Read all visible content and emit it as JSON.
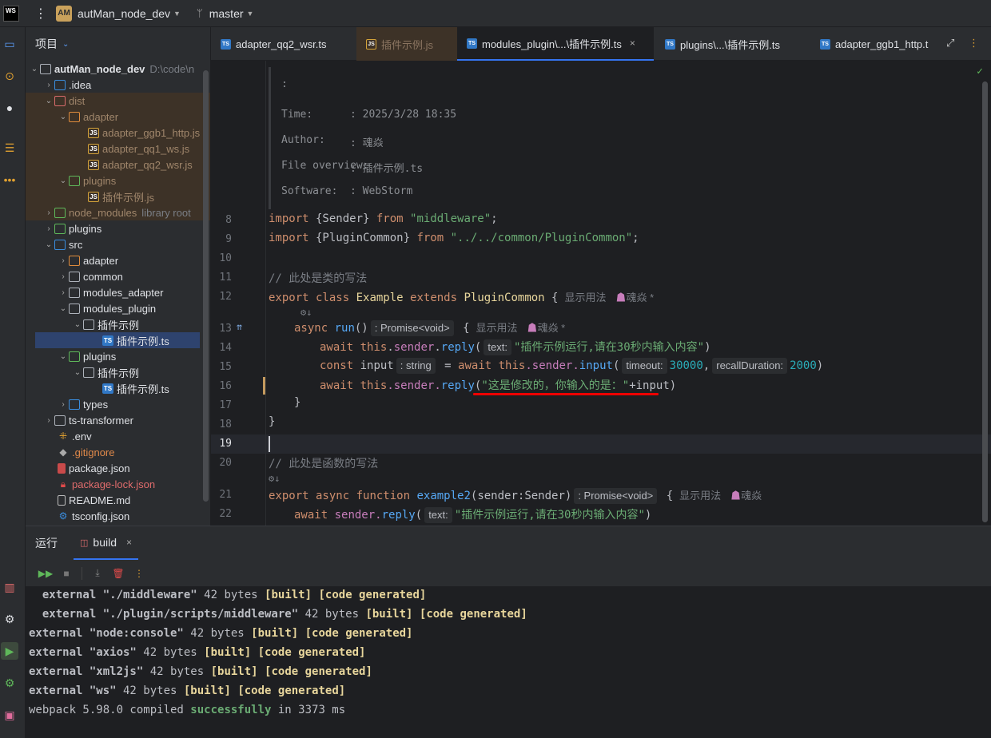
{
  "titlebar": {
    "logo_text": "WS",
    "menu_glyph": "⋮",
    "project_badge": "AM",
    "project_name": "autMan_node_dev",
    "branch": "master"
  },
  "project_panel": {
    "title": "项目",
    "tree": [
      {
        "label": "autMan_node_dev",
        "hint": "D:\\code\\n",
        "arrow": "⌄",
        "icon": "folder"
      },
      {
        "label": ".idea",
        "arrow": "›",
        "icon": "folder"
      },
      {
        "label": "dist",
        "arrow": "⌄",
        "icon": "folder"
      },
      {
        "label": "adapter",
        "arrow": "⌄",
        "icon": "folder"
      },
      {
        "label": "adapter_ggb1_http.js",
        "icon": "JS"
      },
      {
        "label": "adapter_qq1_ws.js",
        "icon": "JS"
      },
      {
        "label": "adapter_qq2_wsr.js",
        "icon": "JS"
      },
      {
        "label": "plugins",
        "arrow": "⌄",
        "icon": "folder"
      },
      {
        "label": "插件示例.js",
        "icon": "JS"
      },
      {
        "label": "node_modules",
        "hint": "library root",
        "arrow": "›",
        "icon": "folder"
      },
      {
        "label": "plugins",
        "arrow": "›",
        "icon": "folder"
      },
      {
        "label": "src",
        "arrow": "⌄",
        "icon": "folder"
      },
      {
        "label": "adapter",
        "arrow": "›",
        "icon": "folder"
      },
      {
        "label": "common",
        "arrow": "›",
        "icon": "folder"
      },
      {
        "label": "modules_adapter",
        "arrow": "›",
        "icon": "folder"
      },
      {
        "label": "modules_plugin",
        "arrow": "⌄",
        "icon": "folder"
      },
      {
        "label": "插件示例",
        "arrow": "⌄",
        "icon": "folder"
      },
      {
        "label": "插件示例.ts",
        "icon": "TS"
      },
      {
        "label": "plugins",
        "arrow": "⌄",
        "icon": "folder"
      },
      {
        "label": "插件示例",
        "arrow": "⌄",
        "icon": "folder"
      },
      {
        "label": "插件示例.ts",
        "icon": "TS"
      },
      {
        "label": "types",
        "arrow": "›",
        "icon": "folder"
      },
      {
        "label": "ts-transformer",
        "arrow": "›",
        "icon": "folder"
      },
      {
        "label": ".env",
        "icon": "env"
      },
      {
        "label": ".gitignore",
        "icon": "git"
      },
      {
        "label": "package.json",
        "icon": "json"
      },
      {
        "label": "package-lock.json",
        "icon": "lock"
      },
      {
        "label": "README.md",
        "icon": "md"
      },
      {
        "label": "tsconfig.json",
        "icon": "ts-config"
      }
    ]
  },
  "tabs": [
    {
      "label": "adapter_qq2_wsr.ts",
      "icon": "TS"
    },
    {
      "label": "插件示例.js",
      "icon": "JS"
    },
    {
      "label": "modules_plugin\\...\\插件示例.ts",
      "icon": "TS",
      "close": "×"
    },
    {
      "label": "plugins\\...\\插件示例.ts",
      "icon": "TS"
    },
    {
      "label": "adapter_ggb1_http.t",
      "icon": "TS"
    }
  ],
  "editor": {
    "doc": {
      "colon": ":",
      "time_label": "Time:",
      "time_value": ": 2025/3/28 18:35",
      "author_label": "Author:",
      "author_value": ": 魂焱",
      "overview_label": "File overview:",
      "overview_value": ": 插件示例.ts",
      "software_label": "Software:",
      "software_value": ": WebStorm"
    },
    "line_numbers": [
      "8",
      "9",
      "10",
      "11",
      "12",
      "13",
      "14",
      "15",
      "16",
      "17",
      "18",
      "19",
      "20",
      "21",
      "22"
    ],
    "code": {
      "l8_import": "import",
      "l8_sender": " {Sender} ",
      "l8_from": "from",
      "l8_mod": " \"middleware\"",
      "l8_semi": ";",
      "l9_import": "import",
      "l9_pc": " {PluginCommon} ",
      "l9_from": "from",
      "l9_mod": " \"../../common/PluginCommon\"",
      "l9_semi": ";",
      "l11_comment": "// 此处是类的写法",
      "l12_export": "export",
      "l12_class": " class ",
      "l12_name": "Example",
      "l12_extends": " extends ",
      "l12_parent": "PluginCommon",
      "l12_brace": " {",
      "lens_usages": "显示用法",
      "lens_author": "魂焱 *",
      "lens_author_plain": "魂焱",
      "l13_async": "async",
      "l13_run": " run",
      "l13_paren": "()",
      "l13_hint": ": Promise<void>",
      "l13_brace": " {",
      "l14_await": "await",
      "l14_this": " this",
      "l14_dot": ".",
      "l14_sender": "sender",
      "l14_dot2": ".",
      "l14_reply": "reply",
      "l14_paren": "(",
      "l14_hint": "text:",
      "l14_str": "\"插件示例运行,请在30秒内输入内容\"",
      "l14_close": ")",
      "l15_const": "const",
      "l15_input": " input",
      "l15_hint": ": string",
      "l15_eq": " = ",
      "l15_await": "await",
      "l15_this": " this",
      "l15_sender": ".sender.",
      "l15_input_fn": "input",
      "l15_paren": "(",
      "l15_hint2": "timeout:",
      "l15_num1": "30000",
      "l15_comma": ",",
      "l15_hint3": "recallDuration:",
      "l15_num2": "2000",
      "l15_close": ")",
      "l16_await": "await",
      "l16_this": " this",
      "l16_sender": ".sender.",
      "l16_reply": "reply",
      "l16_paren": "(",
      "l16_str": "\"这是修改的，你输入的是：\"",
      "l16_rest": "+input)",
      "l17_brace": "}",
      "l18_brace": "}",
      "l20_comment": "// 此处是函数的写法",
      "l21_export": "export",
      "l21_async": " async ",
      "l21_function": "function",
      "l21_name": " example2",
      "l21_params": "(sender:Sender)",
      "l21_hint": ": Promise<void>",
      "l21_brace": " {",
      "l22_await": "await",
      "l22_sender": " sender.",
      "l22_reply": "reply",
      "l22_paren": "(",
      "l22_hint": "text:",
      "l22_str": "\"插件示例运行,请在30秒内输入内容\"",
      "l22_close": ")",
      "sub_hint": "⚙↓"
    }
  },
  "bottom": {
    "run_label": "运行",
    "build_label": "build",
    "build_close": "×",
    "console": [
      {
        "a": "  external ",
        "b": "\"./middleware\"",
        "c": " 42 bytes ",
        "d": "[built]",
        "e": " [code generated]"
      },
      {
        "a": "  external ",
        "b": "\"./plugin/scripts/middleware\"",
        "c": " 42 bytes ",
        "d": "[built]",
        "e": " [code generated]"
      },
      {
        "a": "external ",
        "b": "\"node:console\"",
        "c": " 42 bytes ",
        "d": "[built]",
        "e": " [code generated]"
      },
      {
        "a": "external ",
        "b": "\"axios\"",
        "c": " 42 bytes ",
        "d": "[built]",
        "e": " [code generated]"
      },
      {
        "a": "external ",
        "b": "\"xml2js\"",
        "c": " 42 bytes ",
        "d": "[built]",
        "e": " [code generated]"
      },
      {
        "a": "external ",
        "b": "\"ws\"",
        "c": " 42 bytes ",
        "d": "[built]",
        "e": " [code generated]"
      }
    ],
    "compiled_prefix": "webpack 5.98.0 compiled ",
    "compiled_status": "successfully",
    "compiled_suffix": " in 3373 ms"
  },
  "colors": {
    "accent": "#3574f0",
    "keyword": "#cf8e6d",
    "string": "#6aab73",
    "success": "#6aab73",
    "error_underline": "#ee0000"
  }
}
